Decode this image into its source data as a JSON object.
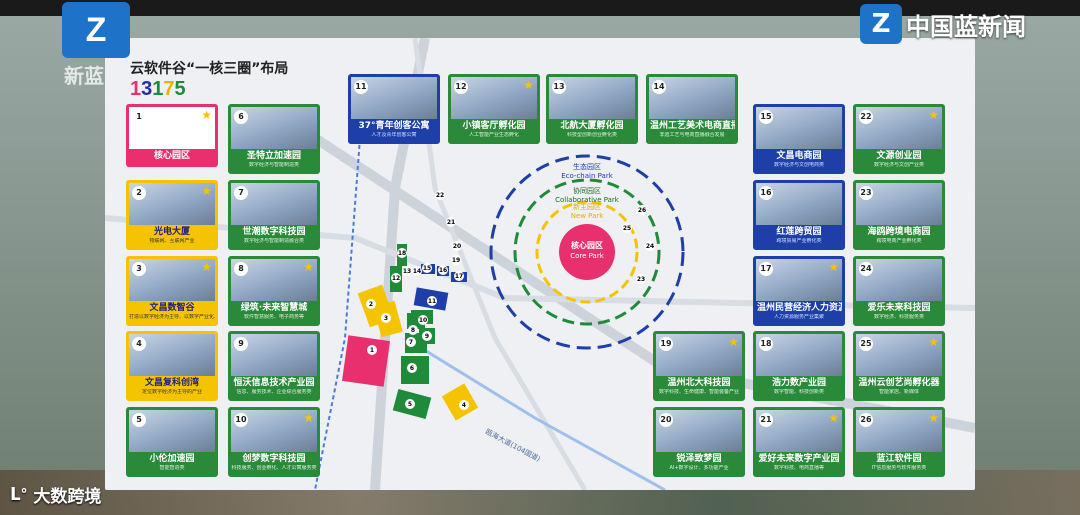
{
  "branding": {
    "top_left_logo": "Z",
    "top_left_sub": "新蓝",
    "top_right_text": "中国蓝新闻",
    "bottom_left_text": "大数跨境",
    "bottom_left_icon": "lo-logo-icon"
  },
  "header": {
    "title": "云软件谷“一核三圈”布局",
    "number_digits": [
      "1",
      "3",
      "1",
      "7",
      "5"
    ]
  },
  "rings": {
    "core": {
      "cn": "核心园区",
      "en": "Core Park",
      "color": "#e8306e"
    },
    "new": {
      "cn": "新主园区",
      "en": "New Park",
      "color": "#f5c400"
    },
    "collab": {
      "cn": "协同园区",
      "en": "Collaborative Park",
      "color": "#1f8a3a"
    },
    "eco": {
      "cn": "生态园区",
      "en": "Eco-chain Park",
      "color": "#1e3fa8"
    }
  },
  "road_label": "瓯海大道(104国道)",
  "cards": [
    {
      "id": "1",
      "label": "核心园区",
      "sub": "",
      "style": "pink",
      "star": true
    },
    {
      "id": "2",
      "label": "光电大厦",
      "sub": "物联网、互联网产业",
      "style": "yellow",
      "star": true
    },
    {
      "id": "3",
      "label": "文昌数智谷",
      "sub": "打造以数字经济为主导、以数字产业化、产业数字化为驱动的生态园",
      "style": "yellow",
      "star": true
    },
    {
      "id": "4",
      "label": "文昌复科创湾",
      "sub": "定位数字经济为主导的产业",
      "style": "yellow",
      "star": false
    },
    {
      "id": "5",
      "label": "小伦加速园",
      "sub": "智能智造类",
      "style": "green",
      "star": false
    },
    {
      "id": "6",
      "label": "圣特立加速园",
      "sub": "数字经济与智能制造类",
      "style": "green",
      "star": false
    },
    {
      "id": "7",
      "label": "世潮数字科技园",
      "sub": "数字经济与智能制造融合类",
      "style": "green",
      "star": false
    },
    {
      "id": "8",
      "label": "绿筑·未来智慧城",
      "sub": "软件智慧服务、电子商务等",
      "style": "green",
      "star": true
    },
    {
      "id": "9",
      "label": "恒沃信息技术产业园",
      "sub": "信息、服务技术、企业综合服务类",
      "style": "green",
      "star": false
    },
    {
      "id": "10",
      "label": "创梦数字科技园",
      "sub": "科技服务、创业孵化、人才公寓服务类",
      "style": "green",
      "star": true
    },
    {
      "id": "11",
      "label": "37°青年创客公寓",
      "sub": "人才及青年创客公寓",
      "style": "blue",
      "star": false
    },
    {
      "id": "12",
      "label": "小镇客厅孵化园",
      "sub": "人工智能产业生态孵化",
      "style": "green",
      "star": true
    },
    {
      "id": "13",
      "label": "北航大厦孵化园",
      "sub": "科技型创新创业孵化类",
      "style": "green",
      "star": false
    },
    {
      "id": "14",
      "label": "温州工艺美术电商直播中心",
      "sub": "非遗工艺与电商直播融合发展",
      "style": "green",
      "star": false
    },
    {
      "id": "15",
      "label": "文昌电商园",
      "sub": "数字经济与文创电商类",
      "style": "blue",
      "star": false
    },
    {
      "id": "16",
      "label": "红莲跨贸园",
      "sub": "跨境贸易产业孵化类",
      "style": "blue",
      "star": false
    },
    {
      "id": "17",
      "label": "温州民营经济人力资源产业园",
      "sub": "人力资源服务产业集聚",
      "style": "blue",
      "star": true
    },
    {
      "id": "18",
      "label": "浩力数产业园",
      "sub": "数字智能、科技创新类",
      "style": "green",
      "star": false
    },
    {
      "id": "19",
      "label": "温州北大科技园",
      "sub": "数字科技、生命健康、智能装备产业",
      "style": "green",
      "star": true
    },
    {
      "id": "20",
      "label": "锐泽致梦园",
      "sub": "AI+数字设计、多功能产业",
      "style": "green",
      "star": false
    },
    {
      "id": "21",
      "label": "爱好未来数字产业园",
      "sub": "数字科技、电商直播等",
      "style": "green",
      "star": true
    },
    {
      "id": "22",
      "label": "文源创业园",
      "sub": "数字经济与文创产业类",
      "style": "green",
      "star": true
    },
    {
      "id": "23",
      "label": "海鸥跨境电商园",
      "sub": "跨境电商产业孵化类",
      "style": "green",
      "star": false
    },
    {
      "id": "24",
      "label": "爱乐未来科技园",
      "sub": "数字经济、科技服务类",
      "style": "green",
      "star": false
    },
    {
      "id": "25",
      "label": "温州云创艺尚孵化器",
      "sub": "智能家居、新媒体",
      "style": "green",
      "star": true
    },
    {
      "id": "26",
      "label": "蓝江软件园",
      "sub": "IT信息服务与软件服务类",
      "style": "green",
      "star": true
    }
  ],
  "map_markers": [
    "1",
    "2",
    "3",
    "4",
    "5",
    "6",
    "7",
    "8",
    "9",
    "10",
    "11",
    "12",
    "13",
    "14",
    "15",
    "16",
    "17",
    "18",
    "19",
    "20",
    "21",
    "22",
    "23",
    "24",
    "25",
    "26"
  ]
}
